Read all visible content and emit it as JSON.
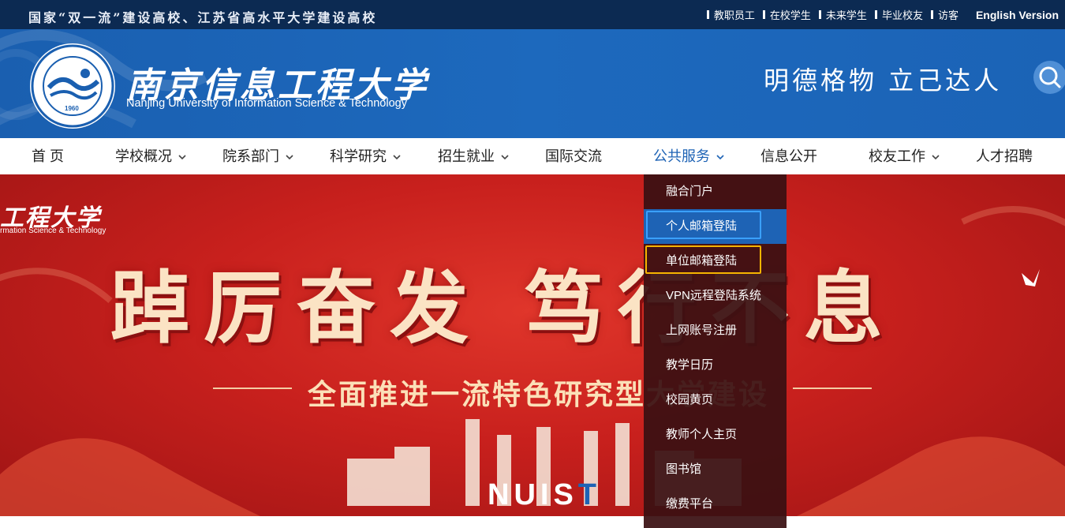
{
  "topbar": {
    "slogan": "国家“双一流”建设高校、江苏省高水平大学建设高校",
    "links": [
      {
        "label": "教职员工"
      },
      {
        "label": "在校学生"
      },
      {
        "label": "未来学生"
      },
      {
        "label": "毕业校友"
      },
      {
        "label": "访客"
      }
    ],
    "english": "English Version"
  },
  "header": {
    "name_cn": "南京信息工程大学",
    "name_en": "Nanjing University of Information Science & Technology",
    "emblem_year": "1960",
    "motto": "明德格物  立己达人",
    "search_icon": "search-icon"
  },
  "nav": {
    "items": [
      {
        "label": "首 页",
        "has_menu": false
      },
      {
        "label": "学校概况",
        "has_menu": true
      },
      {
        "label": "院系部门",
        "has_menu": true
      },
      {
        "label": "科学研究",
        "has_menu": true
      },
      {
        "label": "招生就业",
        "has_menu": true
      },
      {
        "label": "国际交流",
        "has_menu": false
      },
      {
        "label": "公共服务",
        "has_menu": true,
        "active": true
      },
      {
        "label": "信息公开",
        "has_menu": false
      },
      {
        "label": "校友工作",
        "has_menu": true
      },
      {
        "label": "人才招聘",
        "has_menu": false
      }
    ]
  },
  "dropdown": {
    "items": [
      {
        "label": "融合门户"
      },
      {
        "label": "个人邮箱登陆",
        "state": "hover"
      },
      {
        "label": "单位邮箱登陆",
        "state": "focus"
      },
      {
        "label": "VPN远程登陆系统"
      },
      {
        "label": "上网账号注册"
      },
      {
        "label": "教学日历"
      },
      {
        "label": "校园黄页"
      },
      {
        "label": "教师个人主页"
      },
      {
        "label": "图书馆"
      },
      {
        "label": "缴费平台"
      }
    ]
  },
  "banner": {
    "logo_cn": "工程大学",
    "logo_en": "rmation Science & Technology",
    "headline": "踔厉奋发 笃行不息",
    "subline": "全面推进一流特色研究型大学建设",
    "nuist_white": "NUIS",
    "nuist_blue": "T"
  },
  "colors": {
    "topbar_bg": "#0c2a52",
    "header_bg": "#1d69bd",
    "nav_active": "#1e63b5",
    "banner_red": "#c8201d",
    "dropdown_bg": "#3a1012",
    "focus_blue": "#3aa0ff",
    "focus_gold": "#f5b400"
  }
}
